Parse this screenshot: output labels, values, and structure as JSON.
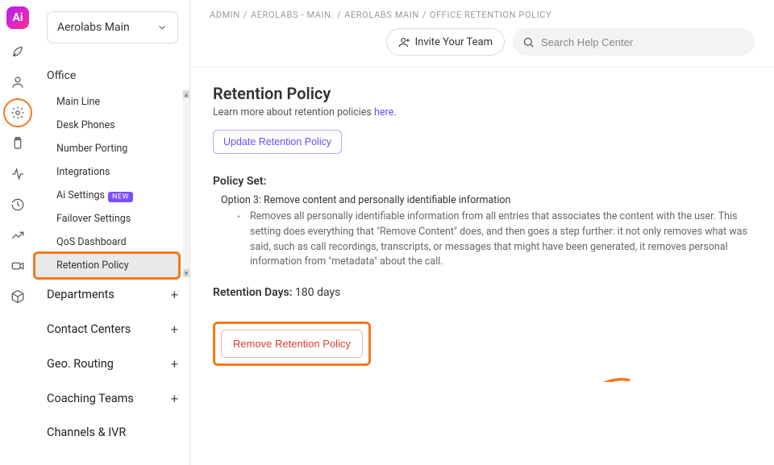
{
  "org_selector": {
    "label": "Aerolabs Main"
  },
  "rail": {
    "items": [
      {
        "name": "logo"
      },
      {
        "name": "rocket-icon"
      },
      {
        "name": "user-icon"
      },
      {
        "name": "gear-icon",
        "active": true
      },
      {
        "name": "clipboard-icon"
      },
      {
        "name": "activity-icon"
      },
      {
        "name": "history-icon"
      },
      {
        "name": "trend-icon"
      },
      {
        "name": "camera-icon"
      },
      {
        "name": "cube-icon"
      }
    ]
  },
  "sidebar": {
    "section_label": "Office",
    "tree": [
      {
        "label": "Main Line"
      },
      {
        "label": "Desk Phones"
      },
      {
        "label": "Number Porting"
      },
      {
        "label": "Integrations"
      },
      {
        "label": "Ai Settings",
        "badge": "NEW"
      },
      {
        "label": "Failover Settings"
      },
      {
        "label": "QoS Dashboard"
      },
      {
        "label": "Retention Policy",
        "active": true
      }
    ],
    "categories": [
      {
        "label": "Departments",
        "expandable": true
      },
      {
        "label": "Contact Centers",
        "expandable": true
      },
      {
        "label": "Geo. Routing",
        "expandable": true
      },
      {
        "label": "Coaching Teams",
        "expandable": true
      },
      {
        "label": "Channels & IVR",
        "expandable": false
      }
    ]
  },
  "breadcrumbs": [
    "ADMIN",
    "AEROLABS - MAIN.",
    "AEROLABS MAIN",
    "OFFICE RETENTION POLICY"
  ],
  "topbar": {
    "invite_label": "Invite Your Team",
    "search_placeholder": "Search Help Center"
  },
  "page": {
    "title": "Retention Policy",
    "subtext_pre": "Learn more about retention policies ",
    "subtext_link": "here",
    "subtext_post": ".",
    "update_btn": "Update Retention Policy",
    "policy_set_heading": "Policy Set:",
    "option_title": "Option 3: Remove content and personally identifiable information",
    "option_desc": "Removes all personally identifiable information from all entries that associates the content with the user. This setting does everything that \"Remove Content\" does, and then goes a step further: it not only removes what was said, such as call recordings, transcripts, or messages that might have been generated, it removes personal information from \"metadata\" about the call.",
    "retention_days_label": "Retention Days:",
    "retention_days_value": "180 days",
    "remove_btn": "Remove Retention Policy"
  }
}
